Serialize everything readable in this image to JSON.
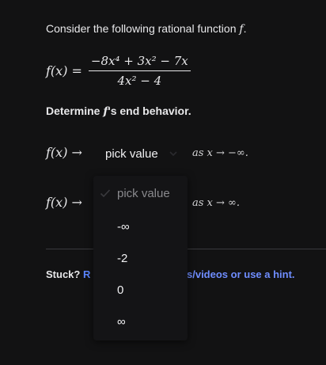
{
  "question": {
    "prompt_prefix": "Consider the following rational function ",
    "prompt_var": "f",
    "prompt_suffix": ".",
    "formula_lhs": "f(x) =",
    "numerator": "−8x⁴ + 3x² − 7x",
    "denominator": "4x² − 4",
    "determine_prefix": "Determine ",
    "determine_var": "f",
    "determine_suffix": "'s end behavior."
  },
  "rows": [
    {
      "label": "f(x) →",
      "select_value": "pick value",
      "condition": "as x → −∞."
    },
    {
      "label": "f(x) →",
      "condition": "as x → ∞."
    }
  ],
  "dropdown": {
    "options": [
      "pick value",
      "-∞",
      "-2",
      "0",
      "∞"
    ],
    "selected": "pick value"
  },
  "help": {
    "stuck_label": "Stuck?",
    "link_visible_start": "R",
    "link_visible_end": "s/videos or use a hint."
  },
  "colors": {
    "background": "#121213",
    "text": "#e8e8ea",
    "link": "#5b86ff",
    "muted": "#8a8a8e"
  }
}
